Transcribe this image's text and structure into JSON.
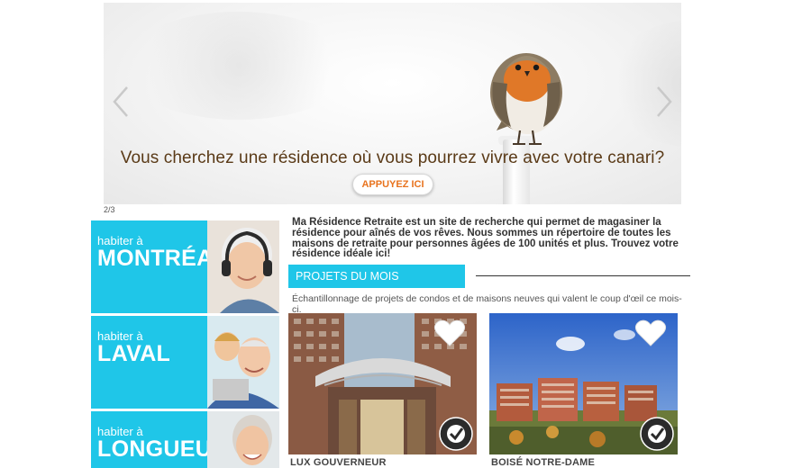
{
  "hero": {
    "caption": "Vous cherchez une résidence où vous pourrez vivre avec votre canari?",
    "cta_label": "APPUYEZ ICI",
    "counter": "2/3",
    "prev_icon": "chevron-left-icon",
    "next_icon": "chevron-right-icon"
  },
  "cities": [
    {
      "small": "habiter à",
      "name": "MONTRÉAL"
    },
    {
      "small": "habiter à",
      "name": "LAVAL"
    },
    {
      "small": "habiter à",
      "name": "LONGUEUIL"
    }
  ],
  "intro": {
    "text": "Ma Résidence Retraite est un site de recherche qui permet de magasiner la résidence pour aînés de vos rêves. Nous sommes un répertoire de toutes les maisons de retraite pour personnes âgées de 100 unités et plus. Trouvez votre résidence idéale ici!"
  },
  "projects": {
    "heading": "PROJETS DU MOIS",
    "description": "Échantillonnage de projets de condos et de maisons neuves qui valent le coup d'œil ce mois-ci.",
    "items": [
      {
        "title": "LUX GOUVERNEUR",
        "icons": [
          "heart-icon",
          "residence-collection-badge-icon"
        ]
      },
      {
        "title": "BOISÉ NOTRE-DAME",
        "icons": [
          "heart-icon",
          "residence-collection-badge-icon"
        ]
      }
    ]
  },
  "colors": {
    "accent": "#1fc6e8",
    "cta_text": "#e8731e",
    "caption_text": "#5a3a17"
  }
}
